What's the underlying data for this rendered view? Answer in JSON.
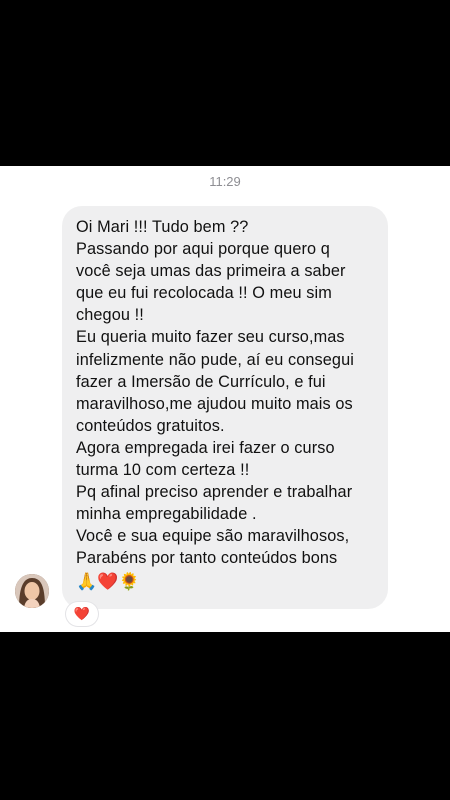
{
  "conversation": {
    "timestamp": "11:29",
    "message": {
      "lines": [
        "Oi Mari !!! Tudo bem ??",
        "Passando por aqui porque quero q",
        "você seja umas das primeira a saber",
        "que eu fui recolocada !! O meu sim",
        "chegou !!",
        "Eu queria muito fazer seu curso,mas",
        "infelizmente não pude, aí eu consegui",
        "fazer a Imersão de Currículo, e fui",
        "maravilhoso,me ajudou muito mais os",
        "conteúdos gratuitos.",
        "Agora empregada irei fazer o curso",
        "turma 10 com certeza !!",
        "Pq afinal preciso aprender e trabalhar",
        "minha empregabilidade .",
        "Você e sua equipe são maravilhosos,",
        "Parabéns por tanto conteúdos bons"
      ],
      "emojis": "🙏❤️🌻"
    },
    "reaction": "❤️"
  },
  "colors": {
    "bubble": "#efeff0",
    "text": "#111111",
    "timestamp": "#8e8e93",
    "background": "#ffffff",
    "frame": "#000000"
  }
}
